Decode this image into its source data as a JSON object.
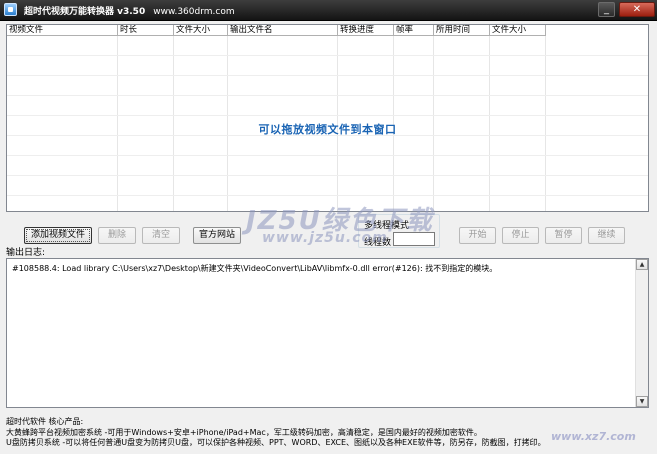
{
  "window": {
    "title": "超时代视频万能转换器 v3.50",
    "site": "www.360drm.com",
    "min_glyph": "_",
    "close_glyph": "✕"
  },
  "table": {
    "columns": [
      "视频文件",
      "时长",
      "文件大小",
      "输出文件名",
      "转换进度",
      "帧率",
      "所用时间",
      "文件大小"
    ],
    "drop_hint": "可以拖放视频文件到本窗口"
  },
  "buttons": {
    "add": "添加视频文件",
    "delete": "删除",
    "clear": "清空",
    "website": "官方网站",
    "start": "开始",
    "stop": "停止",
    "pause": "暂停",
    "resume": "继续"
  },
  "multithread": {
    "mode_label": "多线程模式",
    "threads_label": "线程数",
    "threads_value": ""
  },
  "log": {
    "label": "输出日志:",
    "lines": [
      "#108588.4: Load library C:\\Users\\xz7\\Desktop\\新建文件夹\\VideoConvert\\LibAV\\libmfx-0.dll error(#126): 找不到指定的模块。"
    ],
    "scroll_up": "▲",
    "scroll_down": "▼"
  },
  "footer": {
    "lines": [
      "超时代软件 核心产品:",
      "大黄蜂跨平台视频加密系统 -可用于Windows+安卓+iPhone/iPad+Mac，军工级转码加密，高清稳定，是国内最好的视频加密软件。",
      "U盘防拷贝系统 -可以将任何普通U盘变为防拷贝U盘，可以保护各种视频、PPT、WORD、EXCE、图纸以及各种EXE软件等，防另存，防截图，打拷印。"
    ]
  },
  "watermark": {
    "brand": "JZ5U绿色下载",
    "url": "www.jz5u.com",
    "corner": "www.xz7.com"
  }
}
